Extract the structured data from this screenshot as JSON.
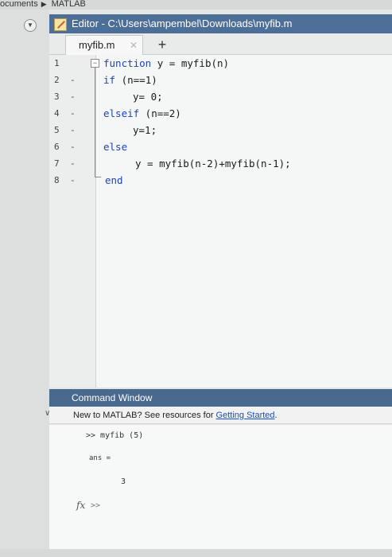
{
  "path_bar": {
    "segment1": "ocuments",
    "separator": "▶",
    "segment2": "MATLAB"
  },
  "editor": {
    "title": "Editor - C:\\Users\\ampembel\\Downloads\\myfib.m",
    "tab_label": "myfib.m",
    "tab_close": "✕",
    "tab_add": "+",
    "line_numbers": [
      "1",
      "2",
      "3",
      "4",
      "5",
      "6",
      "7",
      "8"
    ],
    "code_lines": {
      "l1_kw": "function",
      "l1_rest": " y = myfib(n)",
      "l2_kw": "if",
      "l2_rest": " (n==1)",
      "l3": "y= 0;",
      "l4_kw": "elseif",
      "l4_rest": " (n==2)",
      "l5": "y=1;",
      "l6_kw": "else",
      "l7": "y = myfib(n-2)+myfib(n-1);",
      "l8_kw": "end"
    },
    "colors": {
      "keyword": "#1d44b8",
      "titlebar": "#4c6e97"
    }
  },
  "command_window": {
    "title": "Command Window",
    "notice_text": "New to MATLAB? See resources for ",
    "notice_link": "Getting Started",
    "notice_end": ".",
    "prompt_line": ">> myfib (5)",
    "ans_label": "ans =",
    "ans_value": "3",
    "fx_label": "fx",
    "prompt": ">>"
  }
}
